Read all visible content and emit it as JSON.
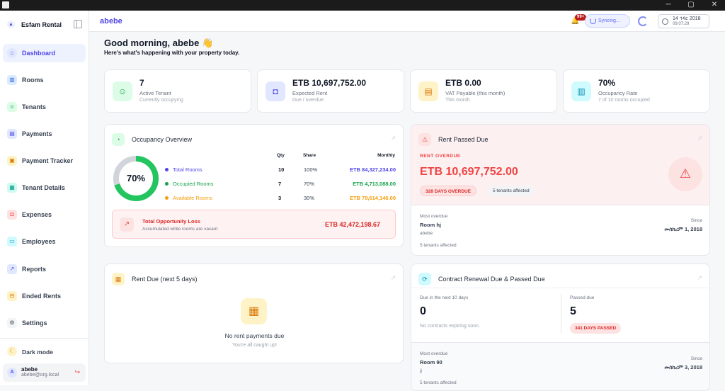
{
  "window": {
    "minimize": "─",
    "maximize": "▢",
    "close": "✕"
  },
  "sidebar": {
    "brand": "Esfam Rental",
    "items": [
      {
        "label": "Dashboard",
        "icon": "home-icon"
      },
      {
        "label": "Rooms",
        "icon": "building-icon"
      },
      {
        "label": "Tenants",
        "icon": "users-icon"
      },
      {
        "label": "Payments",
        "icon": "receipt-icon"
      },
      {
        "label": "Payment Tracker",
        "icon": "tracker-icon"
      },
      {
        "label": "Tenant Details",
        "icon": "document-icon"
      },
      {
        "label": "Expenses",
        "icon": "wallet-icon"
      },
      {
        "label": "Employees",
        "icon": "id-card-icon"
      },
      {
        "label": "Reports",
        "icon": "chart-icon"
      },
      {
        "label": "Ended Rents",
        "icon": "ended-icon"
      },
      {
        "label": "Settings",
        "icon": "gear-icon"
      }
    ],
    "dark_mode": "Dark mode",
    "user": {
      "initial": "A",
      "name": "abebe",
      "email": "abebe@org.local"
    }
  },
  "topbar": {
    "username": "abebe",
    "notif_count": "99+",
    "sync_label": "Syncing...",
    "date": "14 ኅዳር 2018",
    "time": "09:07:29"
  },
  "greeting": {
    "title": "Good morning, abebe 👋",
    "subtitle": "Here's what's happening with your property today."
  },
  "stats": [
    {
      "value": "7",
      "label": "Active Tenant",
      "sub": "Currently occupying",
      "color": "#16a34a"
    },
    {
      "value": "ETB 10,697,752.00",
      "label": "Expected Rent",
      "sub": "Due / overdue",
      "color": "#4f46e5"
    },
    {
      "value": "ETB 0.00",
      "label": "VAT Payable (this month)",
      "sub": "This month",
      "color": "#d97706"
    },
    {
      "value": "70%",
      "label": "Occupancy Rate",
      "sub": "7 of 10 rooms occupied",
      "color": "#0891b2"
    }
  ],
  "occupancy": {
    "title": "Occupancy Overview",
    "percent": "70%",
    "occupied_fraction": 0.7,
    "headers": {
      "qty": "Qty",
      "share": "Share",
      "monthly": "Monthly"
    },
    "rows": [
      {
        "name": "Total Rooms",
        "qty": "10",
        "share": "100%",
        "monthly": "ETB 84,327,234.00",
        "color": "#4f46e5"
      },
      {
        "name": "Occupied Rooms",
        "qty": "7",
        "share": "70%",
        "monthly": "ETB 4,713,088.00",
        "color": "#16a34a"
      },
      {
        "name": "Available Rooms",
        "qty": "3",
        "share": "30%",
        "monthly": "ETB 79,614,146.00",
        "color": "#f59e0b"
      }
    ],
    "loss_title": "Total Opportunity Loss",
    "loss_sub": "Accumulated while rooms are vacant",
    "loss_value": "ETB 42,472,198.67"
  },
  "rent_passed": {
    "title": "Rent Passed Due",
    "overdue_label": "RENT OVERDUE",
    "amount": "ETB 10,697,752.00",
    "days_pill": "328 DAYS OVERDUE",
    "tenants_pill": "5 tenants affected",
    "most_overdue_label": "Most overdue",
    "room": "Room hj",
    "tenant": "abebe",
    "affected": "5 tenants affected",
    "since_label": "Since",
    "since_date": "መስከረም 1, 2018"
  },
  "rent_due": {
    "title": "Rent Due (next 5 days)",
    "empty_title": "No rent payments due",
    "empty_sub": "You're all caught up!"
  },
  "contract": {
    "title": "Contract Renewal Due & Passed Due",
    "due_label": "Due in the next 10 days",
    "due_value": "0",
    "due_note": "No contracts expiring soon.",
    "passed_label": "Passed due",
    "passed_value": "5",
    "passed_pill": "341 DAYS PASSED",
    "most_overdue_label": "Most overdue",
    "room": "Room 90",
    "tenant": "jj",
    "affected": "5 tenants affected",
    "since_label": "Since",
    "since_date": "መስከረም 3, 2018"
  }
}
